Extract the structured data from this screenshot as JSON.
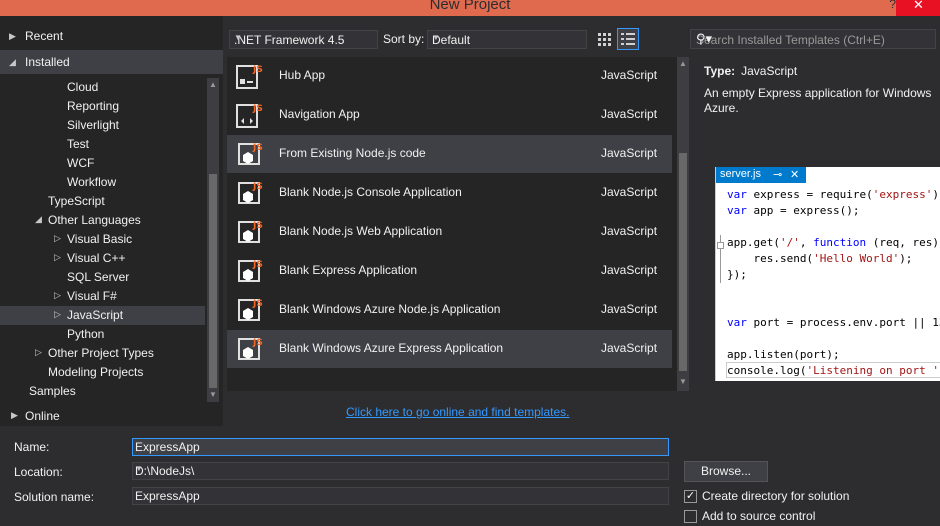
{
  "window": {
    "title": "New Project",
    "help": "?",
    "close": "✕"
  },
  "left": {
    "recent": "Recent",
    "installed": "Installed",
    "tree": [
      "Cloud",
      "Reporting",
      "Silverlight",
      "Test",
      "WCF",
      "Workflow",
      "TypeScript",
      "Other Languages",
      "Visual Basic",
      "Visual C++",
      "SQL Server",
      "Visual F#",
      "JavaScript",
      "Python",
      "Other Project Types",
      "Modeling Projects",
      "Samples"
    ],
    "online": "Online"
  },
  "toolbar": {
    "framework": ".NET Framework 4.5",
    "sort_label": "Sort by:",
    "sort_value": "Default",
    "search_placeholder": "Search Installed Templates (Ctrl+E)"
  },
  "templates": [
    {
      "name": "Hub App",
      "lang": "JavaScript"
    },
    {
      "name": "Navigation App",
      "lang": "JavaScript"
    },
    {
      "name": "From Existing Node.js code",
      "lang": "JavaScript"
    },
    {
      "name": "Blank Node.js Console Application",
      "lang": "JavaScript"
    },
    {
      "name": "Blank Node.js Web Application",
      "lang": "JavaScript"
    },
    {
      "name": "Blank Express Application",
      "lang": "JavaScript"
    },
    {
      "name": "Blank Windows Azure Node.js Application",
      "lang": "JavaScript"
    },
    {
      "name": "Blank Windows Azure Express Application",
      "lang": "JavaScript"
    }
  ],
  "details": {
    "type_label": "Type:",
    "type_value": "JavaScript",
    "description": "An empty Express application for Windows Azure.",
    "preview_tab": "server.js",
    "pin": "⊸",
    "close": "✕"
  },
  "online_link": "Click here to go online and find templates.",
  "form": {
    "name_label": "Name:",
    "name_value": "ExpressApp",
    "location_label": "Location:",
    "location_value": "D:\\NodeJs\\",
    "solution_label": "Solution name:",
    "solution_value": "ExpressApp",
    "browse": "Browse...",
    "create_dir": "Create directory for solution",
    "create_dir_checked": true,
    "source_control": "Add to source control",
    "source_control_checked": false
  }
}
